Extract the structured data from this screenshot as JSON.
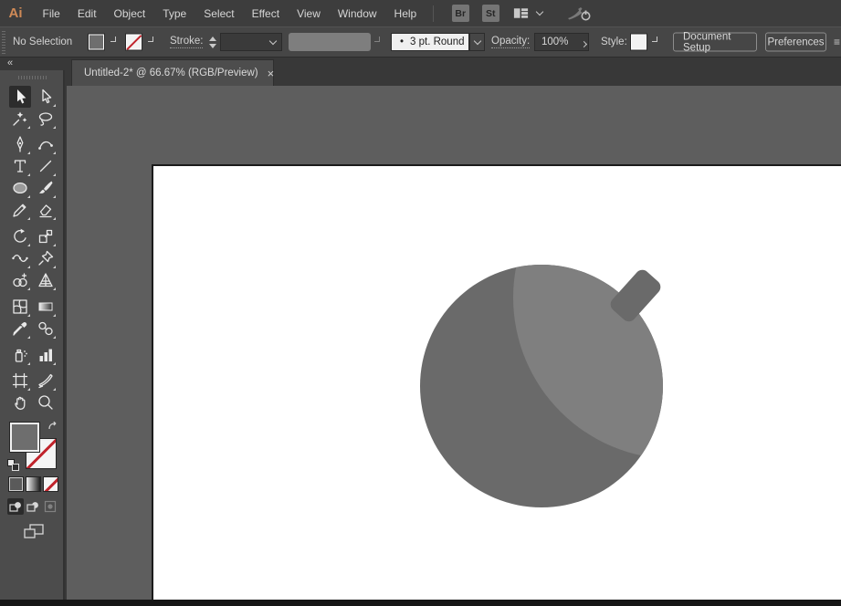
{
  "app": {
    "logo": "Ai"
  },
  "menubar": {
    "items": [
      "File",
      "Edit",
      "Object",
      "Type",
      "Select",
      "Effect",
      "View",
      "Window",
      "Help"
    ],
    "bridge_button": "Br",
    "stock_button": "St",
    "workspace_icon": "workspace-switcher-icon",
    "gpu_icon": "gpu-performance-icon"
  },
  "control_bar": {
    "selection_status": "No Selection",
    "stroke_label": "Stroke:",
    "brush_bullet": "•",
    "brush_value": "3 pt. Round",
    "opacity_label": "Opacity:",
    "opacity_value": "100%",
    "style_label": "Style:",
    "document_setup_button": "Document Setup",
    "preferences_button": "Preferences",
    "panel_menu_glyph": "≡"
  },
  "tab_bar": {
    "active_tab": {
      "title": "Untitled-2* @ 66.67% (RGB/Preview)",
      "close_glyph": "×"
    }
  },
  "toolbar": {
    "collapse_glyph": "«",
    "selected_tool": "selection-tool",
    "tools": [
      "selection-tool",
      "direct-selection-tool",
      "magic-wand-tool",
      "lasso-tool",
      "pen-tool",
      "curvature-tool",
      "type-tool",
      "line-segment-tool",
      "ellipse-tool",
      "paintbrush-tool",
      "pencil-tool",
      "eraser-tool",
      "rotate-tool",
      "scale-tool",
      "width-tool",
      "free-transform-tool",
      "shape-builder-tool",
      "perspective-grid-tool",
      "mesh-tool",
      "gradient-tool",
      "eyedropper-tool",
      "blend-tool",
      "symbol-sprayer-tool",
      "column-graph-tool",
      "artboard-tool",
      "slice-tool",
      "hand-tool",
      "zoom-tool"
    ]
  },
  "artwork": {
    "artboard_color": "#ffffff",
    "bomb_body_color": "#6a6a6a",
    "bomb_highlight_color": "#7f7f7f",
    "bomb_cap_color": "#6a6a6a"
  },
  "colors": {
    "logo_orange": "#cf8a57",
    "none_slash_red": "#c0232b",
    "ui_dark": "#3d3d3d",
    "pasteboard": "#5e5e5e"
  }
}
